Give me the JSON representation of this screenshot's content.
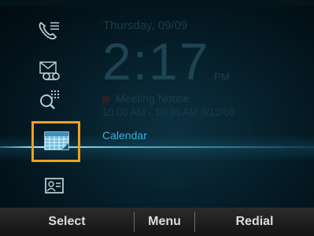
{
  "home": {
    "date": "Thursday, 09/09",
    "time": "2:17",
    "ampm": "PM",
    "event_title": "Meeting Notice",
    "event_detail": "10:00 AM - 10:30 AM 9/12/06",
    "selected_label": "Calendar"
  },
  "softkeys": {
    "select": "Select",
    "menu": "Menu",
    "redial": "Redial"
  },
  "icons": [
    "calls-icon",
    "voicemail-icon",
    "directory-icon",
    "calendar-icon",
    "contacts-icon"
  ],
  "colors": {
    "highlight": "#f0a020",
    "accent": "#3ab0dc",
    "background": "#06202b"
  }
}
